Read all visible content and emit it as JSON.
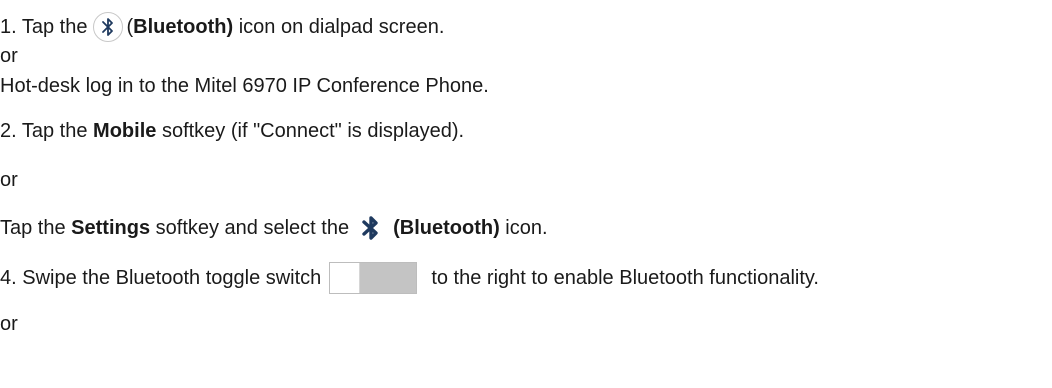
{
  "steps": {
    "step1": {
      "prefix": "1. Tap the",
      "icon_label_bold": "Bluetooth)",
      "icon_label_open_paren": "(",
      "suffix": " icon on dialpad screen."
    },
    "or1": "or",
    "hotdesk": "Hot-desk log in to the Mitel 6970 IP Conference Phone.",
    "step2": {
      "prefix": "2. Tap the ",
      "bold": "Mobile",
      "suffix": " softkey (if \"Connect\" is displayed)."
    },
    "or2": "or",
    "settings_step": {
      "prefix": "Tap the ",
      "bold_settings": "Settings",
      "middle": " softkey and select the",
      "bold_bluetooth": "(Bluetooth)",
      "suffix": " icon."
    },
    "step4": {
      "prefix": "4. Swipe the Bluetooth toggle switch",
      "suffix": "to the right to enable Bluetooth functionality."
    },
    "or3": "or"
  },
  "icons": {
    "bluetooth_outline": "bluetooth-icon",
    "bluetooth_filled": "bluetooth-icon",
    "accent": "#1f3a5f"
  },
  "toggle": {
    "state": "off"
  }
}
